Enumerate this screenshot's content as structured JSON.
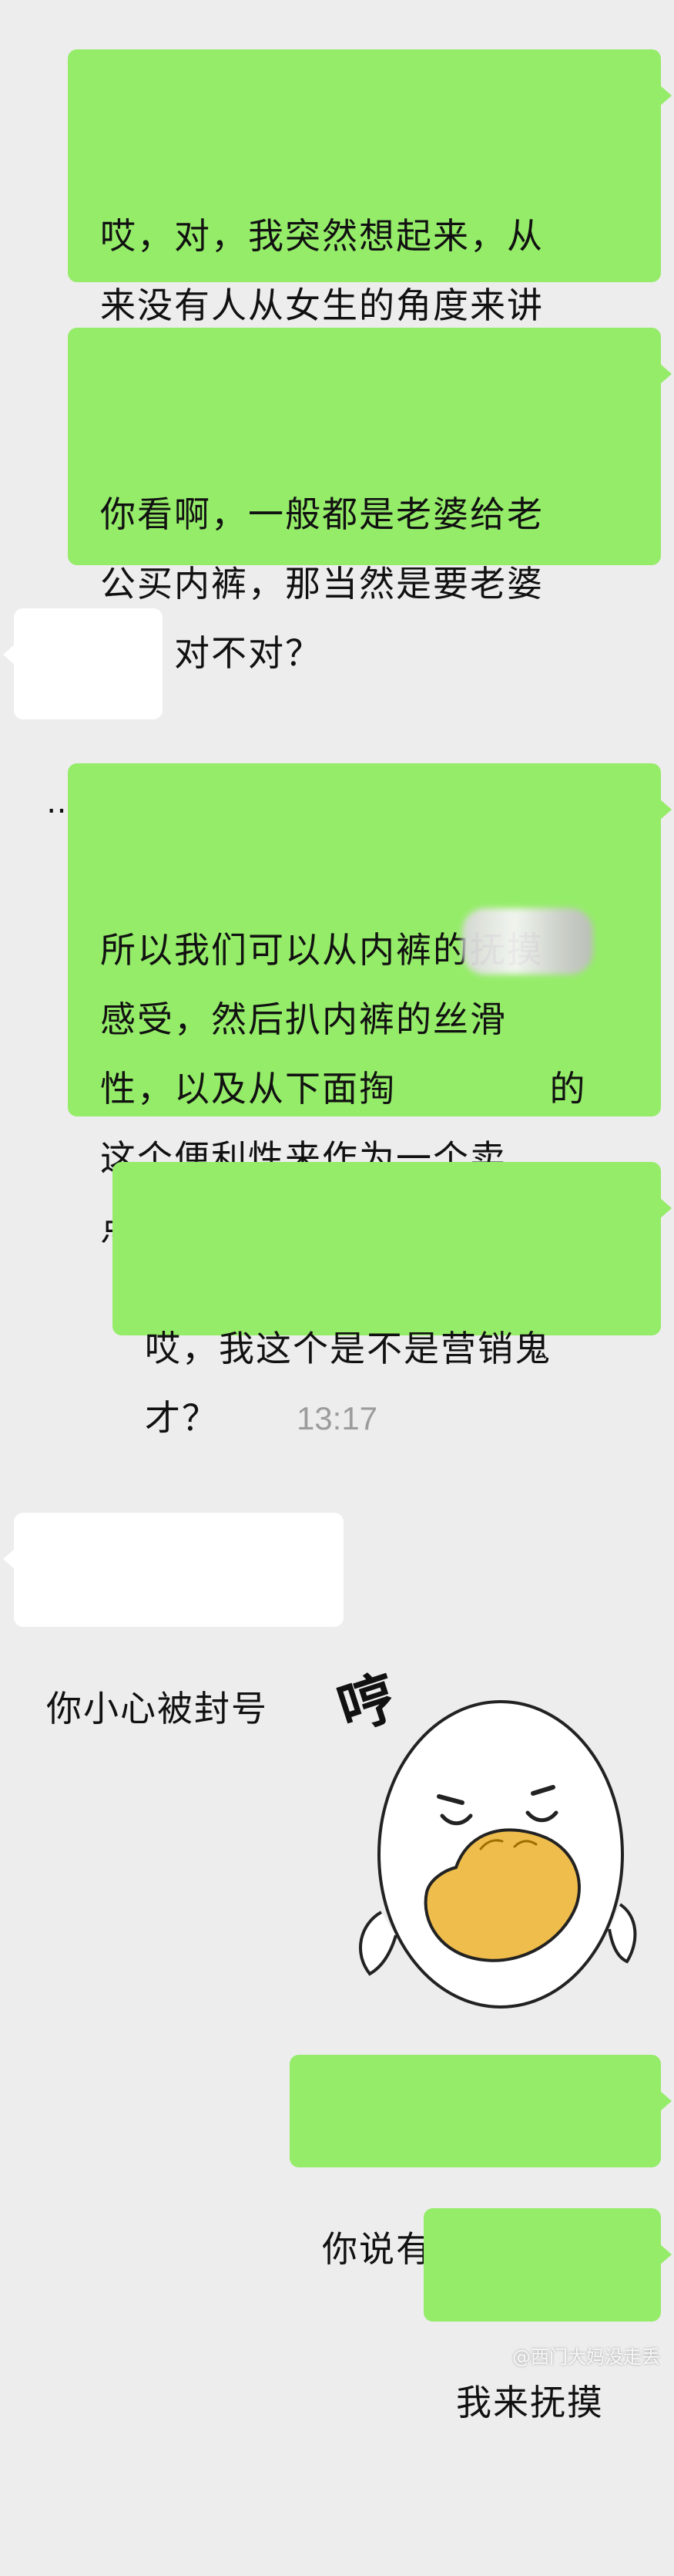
{
  "messages": [
    {
      "id": "m1",
      "side": "sent",
      "text": "哎，对，我突然想起来，从\n来没有人从女生的角度来讲\n男性内裤的使用。"
    },
    {
      "id": "m2",
      "side": "sent",
      "text": "你看啊，一般都是老婆给老\n公买内裤，那当然是要老婆\n爽，对不对？"
    },
    {
      "id": "m3",
      "side": "recv",
      "text": "……"
    },
    {
      "id": "m4",
      "side": "sent",
      "text": "所以我们可以从内裤的抚摸\n感受，然后扒内裤的丝滑\n性，以及从下面掏            的\n这个便利性来作为一个卖\n点。"
    },
    {
      "id": "m5",
      "side": "sent",
      "text": "哎，我这个是不是营销鬼\n才？"
    },
    {
      "id": "m6",
      "side": "recv",
      "text": "你小心被封号"
    },
    {
      "id": "m7",
      "side": "sent",
      "text": "你说有没有道理"
    },
    {
      "id": "m8",
      "side": "sent",
      "text": "我来抚摸"
    }
  ],
  "timestamp": "13:17",
  "sticker": {
    "text": "哼",
    "icon": "duck-sticker-icon"
  },
  "watermark": "@西门大妈没走丢",
  "colors": {
    "background": "#ededed",
    "sent_bubble": "#95ec69",
    "received_bubble": "#ffffff",
    "timestamp": "#9c9c9c",
    "sticker_beak": "#efbd4c"
  }
}
